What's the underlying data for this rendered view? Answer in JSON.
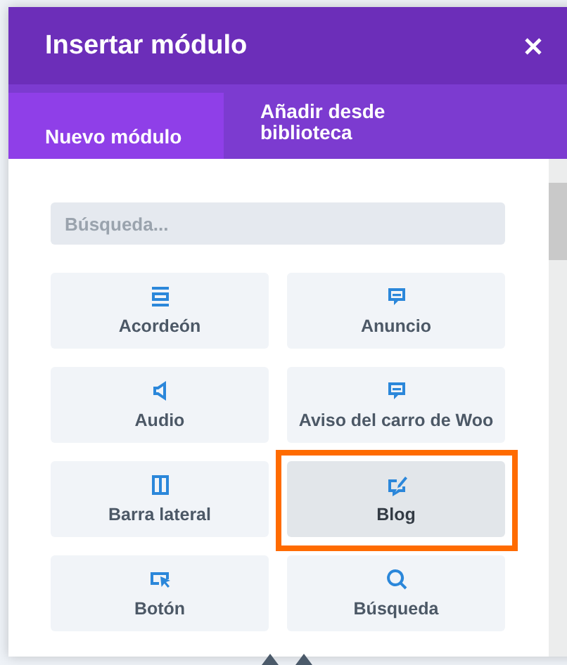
{
  "window": {
    "title": "Insertar módulo"
  },
  "tabs": [
    {
      "label": "Nuevo módulo",
      "selected": true
    },
    {
      "label": "Añadir desde biblioteca",
      "selected": false
    }
  ],
  "search": {
    "placeholder": "Búsqueda..."
  },
  "modules": [
    {
      "label": "Acordeón",
      "kind": "accordion",
      "highlighted": false
    },
    {
      "label": "Anuncio",
      "kind": "message",
      "highlighted": false
    },
    {
      "label": "Audio",
      "kind": "speaker",
      "highlighted": false
    },
    {
      "label": "Aviso del carro de Woo",
      "kind": "message",
      "highlighted": false
    },
    {
      "label": "Barra lateral",
      "kind": "sidebar",
      "highlighted": false
    },
    {
      "label": "Blog",
      "kind": "blog",
      "highlighted": true
    },
    {
      "label": "Botón",
      "kind": "pointer",
      "highlighted": false
    },
    {
      "label": "Búsqueda",
      "kind": "search",
      "highlighted": false
    }
  ]
}
